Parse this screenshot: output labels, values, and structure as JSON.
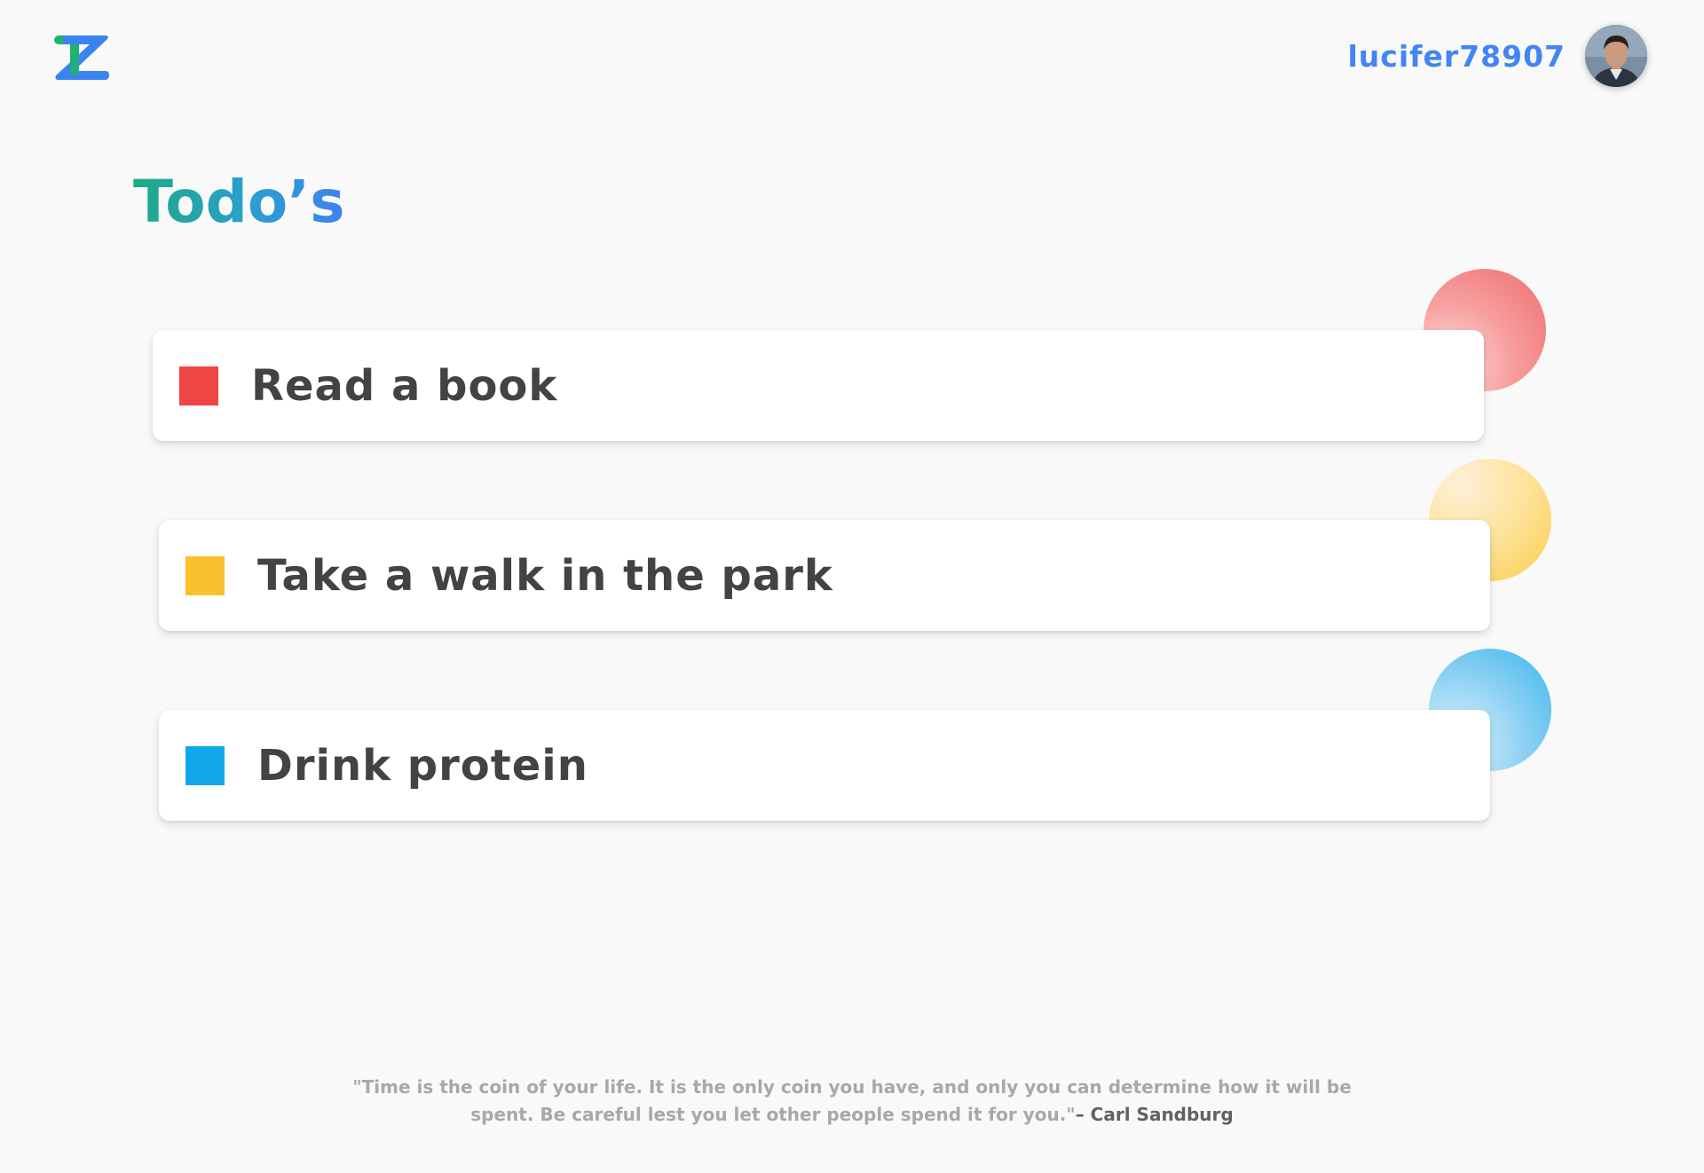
{
  "header": {
    "logo_icon": "zt-logo-icon",
    "username": "lucifer78907",
    "avatar_icon": "user-avatar-icon"
  },
  "page": {
    "title": "Todo’s"
  },
  "todos": [
    {
      "label": "Read a book",
      "color": "#f04545",
      "accent": "#f07878"
    },
    {
      "label": "Take a walk in the park",
      "color": "#fbc02d",
      "accent": "#fcd65d"
    },
    {
      "label": "Drink protein",
      "color": "#11a8ea",
      "accent": "#45b8ee"
    }
  ],
  "quote": {
    "text": "\"Time is the coin of your life. It is the only coin you have, and only you can determine how it will be spent. Be careful lest you let other people spend it for you.\"",
    "author": "– Carl Sandburg"
  },
  "colors": {
    "background": "#f9f9f9",
    "username": "#4285f4",
    "title_gradient_start": "#1faa84",
    "title_gradient_end": "#3f82ef",
    "todo_text": "#434343",
    "quote_text": "#a8a8a8",
    "quote_author": "#616161"
  }
}
